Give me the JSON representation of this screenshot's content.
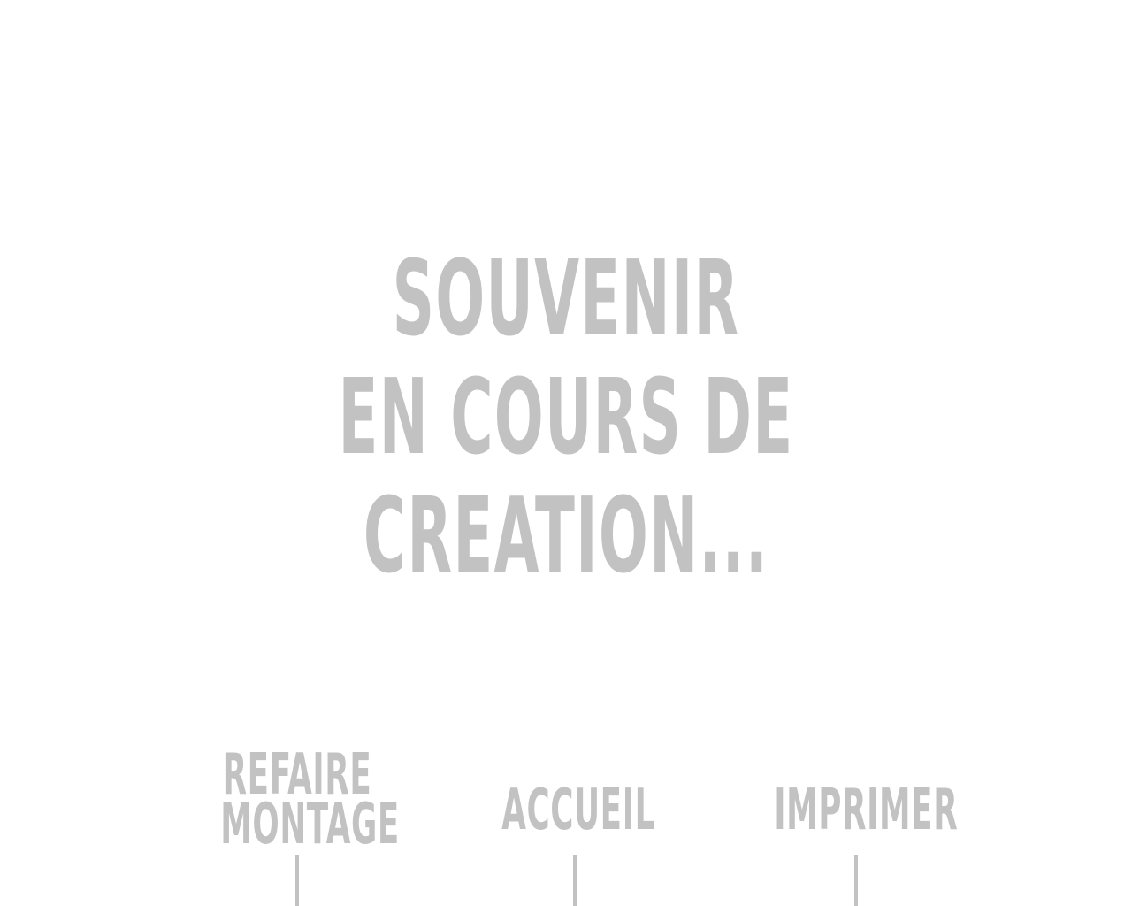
{
  "status": {
    "line1": "SOUVENIR",
    "line2": "EN COURS DE",
    "line3": "CREATION..."
  },
  "actions": {
    "redo": {
      "line1": "REFAIRE",
      "line2": "MONTAGE"
    },
    "home": {
      "label": "ACCUEIL"
    },
    "print": {
      "label": "IMPRIMER"
    }
  },
  "colors": {
    "text": "#c2c2c2",
    "background": "#ffffff"
  }
}
